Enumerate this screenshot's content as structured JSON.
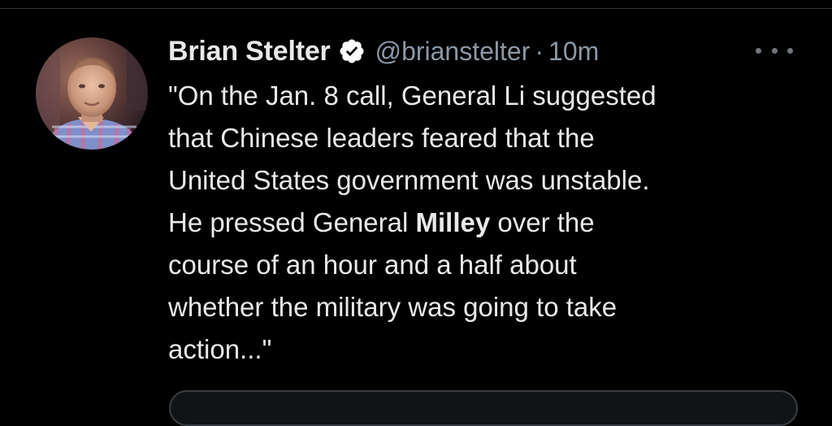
{
  "tweet": {
    "display_name": "Brian Stelter",
    "handle": "@brianstelter",
    "separator": "·",
    "timestamp": "10m",
    "verified": true,
    "text_lines": [
      "\"On the Jan. 8 call, General Li suggested",
      "that Chinese leaders feared that the",
      "United States government was unstable.",
      [
        "He pressed General ",
        "Milley",
        " over the"
      ],
      "course of an hour and a half about",
      "whether the military was going to take",
      "action...\""
    ]
  },
  "icons": {
    "verified": "verified-badge-icon",
    "more": "more-options-icon",
    "avatar": "profile-photo"
  },
  "colors": {
    "background": "#000000",
    "primary_text": "#e7e9ea",
    "secondary_text": "#8b98a5",
    "verified_badge": "#ffffff"
  }
}
